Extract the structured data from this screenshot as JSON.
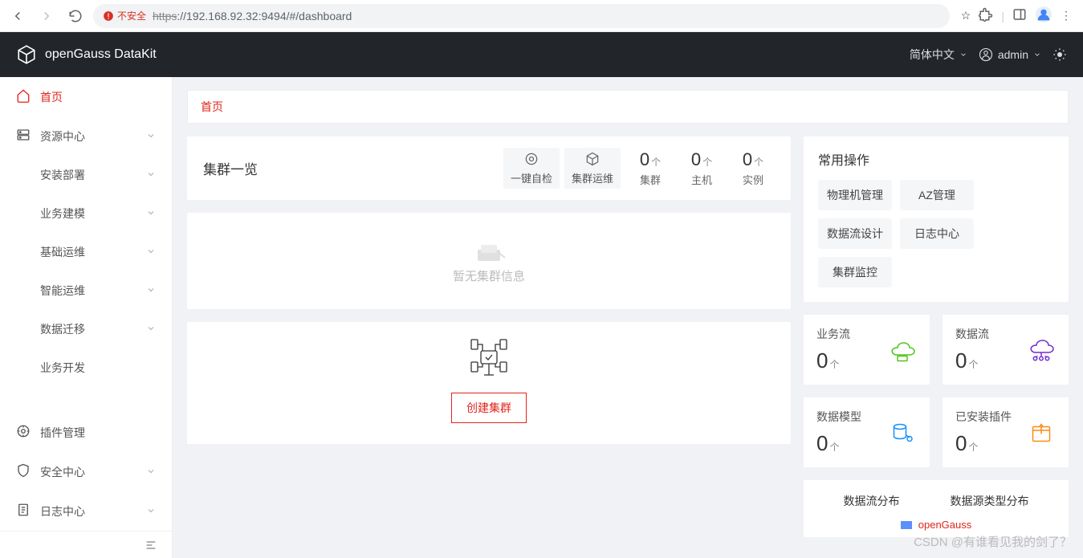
{
  "chrome": {
    "insecure_label": "不安全",
    "url_scheme": "https",
    "url_rest": "://192.168.92.32:9494/#/dashboard"
  },
  "brand": "openGauss DataKit",
  "top": {
    "lang": "简体中文",
    "user": "admin"
  },
  "sidebar": {
    "items": [
      {
        "label": "首页",
        "icon": "home",
        "active": true,
        "expand": false
      },
      {
        "label": "资源中心",
        "icon": "server",
        "expand": true
      },
      {
        "label": "安装部署",
        "icon": "",
        "expand": true
      },
      {
        "label": "业务建模",
        "icon": "",
        "expand": true
      },
      {
        "label": "基础运维",
        "icon": "",
        "expand": true
      },
      {
        "label": "智能运维",
        "icon": "",
        "expand": true
      },
      {
        "label": "数据迁移",
        "icon": "",
        "expand": true
      },
      {
        "label": "业务开发",
        "icon": "",
        "expand": false
      }
    ],
    "footer": [
      {
        "label": "插件管理",
        "icon": "plugin",
        "expand": false
      },
      {
        "label": "安全中心",
        "icon": "shield",
        "expand": true
      },
      {
        "label": "日志中心",
        "icon": "log",
        "expand": true
      }
    ]
  },
  "breadcrumb": "首页",
  "overview": {
    "title": "集群一览",
    "btn1": "一键自检",
    "btn2": "集群运维",
    "stats": [
      {
        "value": "0",
        "unit": "个",
        "label": "集群"
      },
      {
        "value": "0",
        "unit": "个",
        "label": "主机"
      },
      {
        "value": "0",
        "unit": "个",
        "label": "实例"
      }
    ]
  },
  "empty_cluster": "暂无集群信息",
  "create_btn": "创建集群",
  "ops": {
    "title": "常用操作",
    "items": [
      "物理机管理",
      "AZ管理",
      "数据流设计",
      "日志中心",
      "集群监控"
    ]
  },
  "mini": [
    {
      "title": "业务流",
      "value": "0",
      "unit": "个",
      "icon": "cloud-db",
      "color": "#52c41a"
    },
    {
      "title": "数据流",
      "value": "0",
      "unit": "个",
      "icon": "flow",
      "color": "#722ed1"
    },
    {
      "title": "数据模型",
      "value": "0",
      "unit": "个",
      "icon": "model",
      "color": "#1890ff"
    },
    {
      "title": "已安装插件",
      "value": "0",
      "unit": "个",
      "icon": "plugin-box",
      "color": "#fa8c16"
    }
  ],
  "dist": {
    "tab1": "数据流分布",
    "tab2": "数据源类型分布",
    "legend": "openGauss"
  },
  "watermark": "CSDN @有谁看见我的剑了？"
}
